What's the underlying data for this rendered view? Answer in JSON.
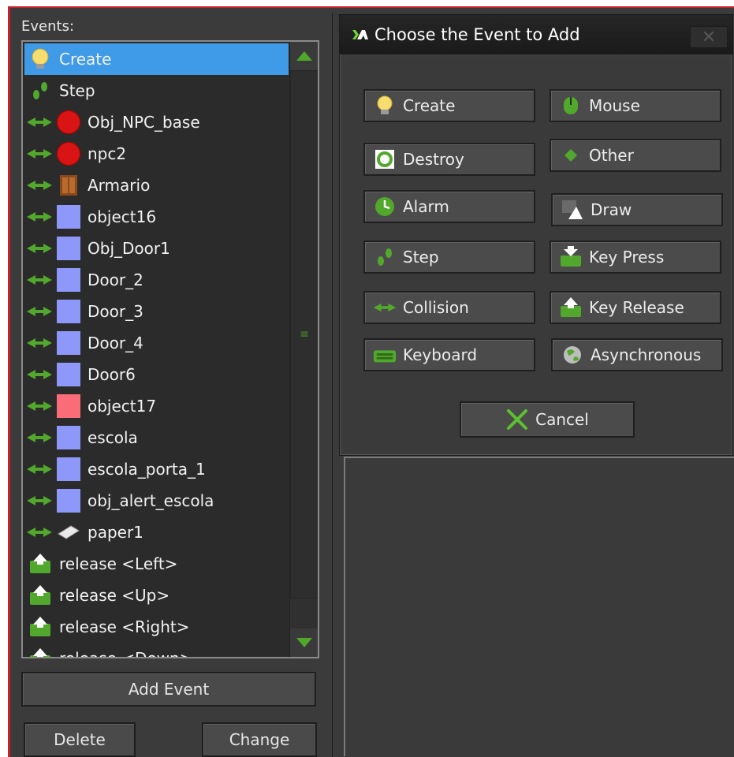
{
  "events_panel": {
    "label": "Events:",
    "items": [
      {
        "label": "Create",
        "kind": "create",
        "selected": true
      },
      {
        "label": "Step",
        "kind": "step"
      },
      {
        "label": "Obj_NPC_base",
        "kind": "collision",
        "sprite": "red-circle"
      },
      {
        "label": "npc2",
        "kind": "collision",
        "sprite": "red-circle"
      },
      {
        "label": "Armario",
        "kind": "collision",
        "sprite": "wardrobe"
      },
      {
        "label": "object16",
        "kind": "collision",
        "sprite": "blue-square"
      },
      {
        "label": "Obj_Door1",
        "kind": "collision",
        "sprite": "blue-square"
      },
      {
        "label": "Door_2",
        "kind": "collision",
        "sprite": "blue-square"
      },
      {
        "label": "Door_3",
        "kind": "collision",
        "sprite": "blue-square"
      },
      {
        "label": "Door_4",
        "kind": "collision",
        "sprite": "blue-square"
      },
      {
        "label": "Door6",
        "kind": "collision",
        "sprite": "blue-square"
      },
      {
        "label": "object17",
        "kind": "collision",
        "sprite": "red-square"
      },
      {
        "label": "escola",
        "kind": "collision",
        "sprite": "blue-square"
      },
      {
        "label": "escola_porta_1",
        "kind": "collision",
        "sprite": "blue-square"
      },
      {
        "label": "obj_alert_escola",
        "kind": "collision",
        "sprite": "blue-square"
      },
      {
        "label": "paper1",
        "kind": "collision",
        "sprite": "paper"
      },
      {
        "label": "release <Left>",
        "kind": "key-release"
      },
      {
        "label": "release <Up>",
        "kind": "key-release"
      },
      {
        "label": "release <Right>",
        "kind": "key-release"
      },
      {
        "label": "release <Down>",
        "kind": "key-release"
      }
    ],
    "add_event_label": "Add Event",
    "delete_label": "Delete",
    "change_label": "Change"
  },
  "dialog": {
    "title": "Choose the Event to Add",
    "close_glyph": "✕",
    "buttons": [
      {
        "label": "Create",
        "icon": "lightbulb-icon"
      },
      {
        "label": "Mouse",
        "icon": "mouse-icon"
      },
      {
        "label": "Destroy",
        "icon": "destroy-icon"
      },
      {
        "label": "Other",
        "icon": "diamond-icon"
      },
      {
        "label": "Alarm",
        "icon": "alarm-icon"
      },
      {
        "label": "Draw",
        "icon": "draw-icon"
      },
      {
        "label": "Step",
        "icon": "step-icon"
      },
      {
        "label": "Key Press",
        "icon": "key-press-icon"
      },
      {
        "label": "Collision",
        "icon": "collision-icon"
      },
      {
        "label": "Key Release",
        "icon": "key-release-icon"
      },
      {
        "label": "Keyboard",
        "icon": "keyboard-icon"
      },
      {
        "label": "Asynchronous",
        "icon": "globe-icon"
      }
    ],
    "cancel_label": "Cancel"
  },
  "colors": {
    "accent_green": "#52a82c",
    "selection": "#3f9ae8",
    "frame_red": "#c8202a"
  }
}
